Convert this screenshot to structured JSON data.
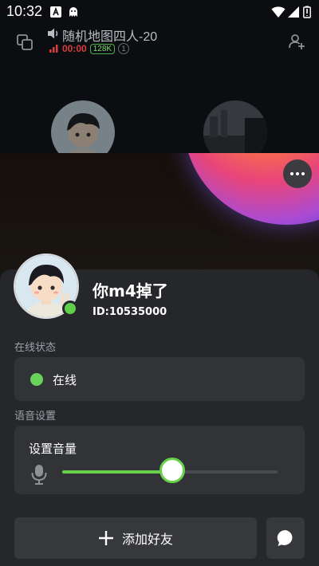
{
  "status_bar": {
    "time": "10:32",
    "icons": [
      "a-app-icon",
      "ghost-icon",
      "wifi-icon",
      "signal-icon",
      "battery-icon"
    ]
  },
  "room": {
    "title": "随机地图四人-20",
    "timer": "00:00",
    "badge": "128K",
    "count": "1"
  },
  "more_menu": {
    "icon": "more-horizontal-icon"
  },
  "profile": {
    "name": "你m4掉了",
    "id": "ID:10535000",
    "online": true
  },
  "online_status": {
    "label": "在线状态",
    "value": "在线",
    "color": "#6ad15a"
  },
  "voice_settings": {
    "label": "语音设置",
    "volume_title": "设置音量",
    "volume_level": 0.51,
    "accent": "#68d14c"
  },
  "actions": {
    "add_friend_label": "添加好友",
    "chat_icon": "chat-bubble-icon"
  }
}
